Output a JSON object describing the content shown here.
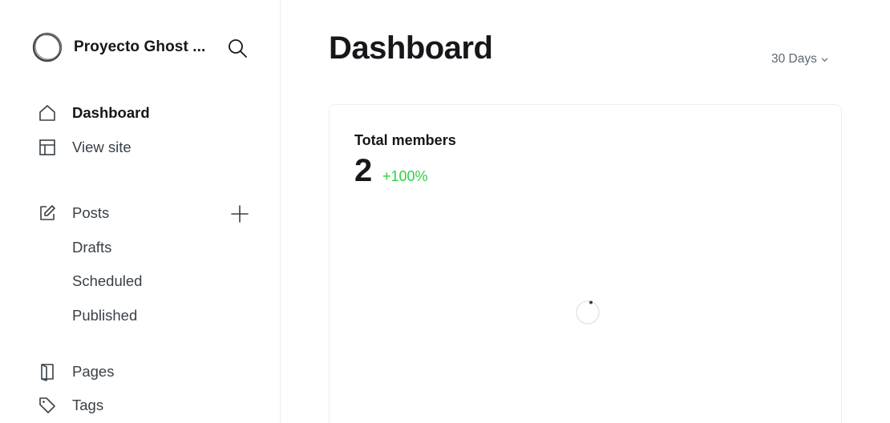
{
  "site": {
    "name": "Proyecto Ghost ..."
  },
  "sidebar": {
    "items": [
      {
        "label": "Dashboard",
        "icon": "home-icon",
        "active": true
      },
      {
        "label": "View site",
        "icon": "layout-icon",
        "active": false
      },
      {
        "label": "Posts",
        "icon": "edit-icon",
        "active": false
      },
      {
        "label": "Drafts"
      },
      {
        "label": "Scheduled"
      },
      {
        "label": "Published"
      },
      {
        "label": "Pages",
        "icon": "pages-icon",
        "active": false
      },
      {
        "label": "Tags",
        "icon": "tag-icon",
        "active": false
      }
    ]
  },
  "header": {
    "title": "Dashboard",
    "range": "30 Days"
  },
  "members_card": {
    "title": "Total members",
    "value": "2",
    "change": "+100%"
  },
  "colors": {
    "positive": "#30cf43",
    "text": "#15171a",
    "muted": "#5d6770",
    "border": "#ebeef0"
  }
}
